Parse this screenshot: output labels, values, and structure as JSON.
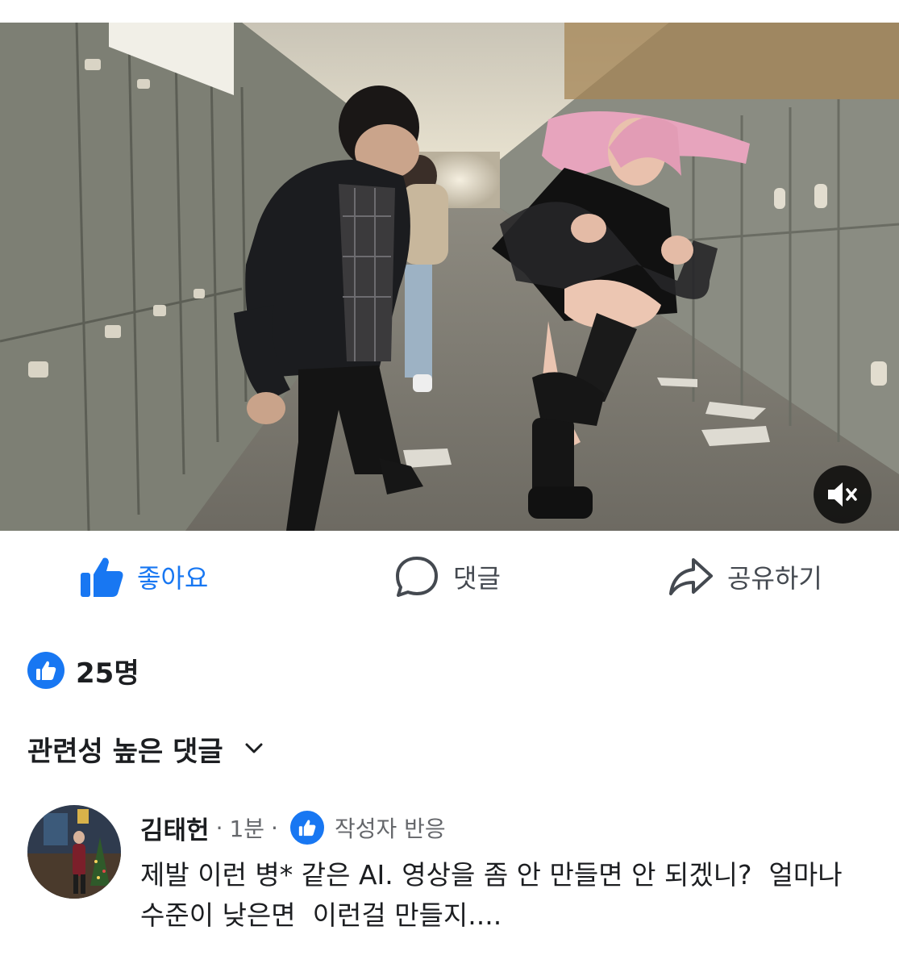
{
  "actions": {
    "like_label": "좋아요",
    "comment_label": "댓글",
    "share_label": "공유하기"
  },
  "reactions": {
    "count_label": "25명"
  },
  "comments_section": {
    "sort_label": "관련성 높은 댓글"
  },
  "comment": {
    "author": "김태헌",
    "time": "1분",
    "separator": "·",
    "author_reaction": "작성자 반응",
    "text": "제발 이런 병* 같은 AI. 영상을 좀 안 만들면 안 되겠니?  얼마나 수준이 낮은면  이런걸 만들지...."
  },
  "colors": {
    "accent": "#1877f2",
    "muted_text": "#65676b",
    "icon_gray": "#444950"
  },
  "icons": {
    "like": "thumbs-up-icon",
    "comment": "speech-bubble-icon",
    "share": "share-arrow-icon",
    "mute": "speaker-muted-icon",
    "sort": "chevron-down-icon"
  }
}
